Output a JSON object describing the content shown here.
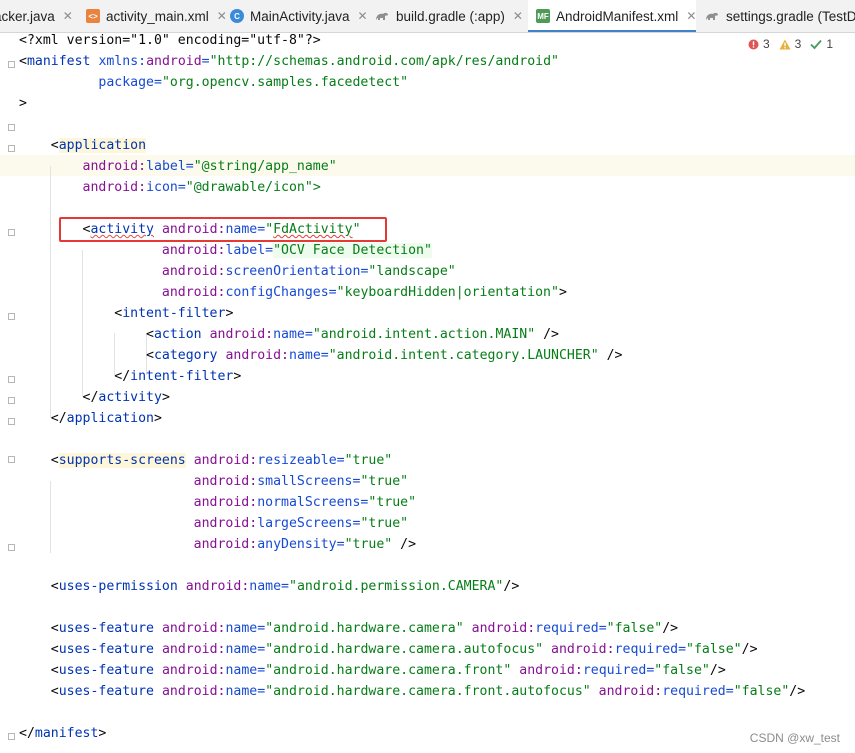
{
  "tabs": [
    {
      "label": "acker.java",
      "icon": "java-file-icon",
      "active": false
    },
    {
      "label": "activity_main.xml",
      "icon": "xml-file-icon",
      "active": false
    },
    {
      "label": "MainActivity.java",
      "icon": "java-class-icon",
      "active": false
    },
    {
      "label": "build.gradle (:app)",
      "icon": "gradle-icon",
      "active": false
    },
    {
      "label": "AndroidManifest.xml",
      "icon": "manifest-file-icon",
      "active": true
    },
    {
      "label": "settings.gradle (TestD",
      "icon": "gradle-icon",
      "active": false
    }
  ],
  "tab_icon_glyphs": {
    "xml": "<>",
    "class": "C",
    "manifest": "MF"
  },
  "inspections": {
    "errors": "3",
    "warnings": "3",
    "weak_warnings": "1"
  },
  "code": {
    "l1_decl": "<?xml version=\"1.0\" encoding=\"utf-8\"?>",
    "l2_open": "<",
    "l2_tag": "manifest",
    "l2_sp": " ",
    "l2_ns": "xmlns:",
    "l2_attr": "android",
    "l2_eq": "=",
    "l2_val": "\"http://schemas.android.com/apk/res/android\"",
    "l3_ind": "          ",
    "l3_attr": "package",
    "l3_eq": "=",
    "l3_val": "\"org.opencv.samples.facedetect\"",
    "l4_close": ">",
    "app_ind": "    <",
    "app_tag": "application",
    "appl_ind": "        ",
    "appl_ns": "android:",
    "appl_attr": "label",
    "appl_eq": "=",
    "appl_val": "\"@string/app_name\"",
    "appi_ind": "        ",
    "appi_ns": "android:",
    "appi_attr": "icon",
    "appi_eq": "=",
    "appi_val": "\"@drawable/icon\">",
    "act_ind": "        <",
    "act_tag": "activity",
    "act_sp": " ",
    "act_ns": "android:",
    "act_attr": "name",
    "act_eq": "=",
    "act_q1": "\"",
    "act_val": "FdActivity",
    "act_q2": "\"",
    "actl_ind": "                  ",
    "actl_ns": "android:",
    "actl_attr": "label",
    "actl_eq": "=",
    "actl_val": "\"OCV Face Detection\"",
    "acts_ind": "                  ",
    "acts_ns": "android:",
    "acts_attr": "screenOrientation",
    "acts_eq": "=",
    "acts_val": "\"landscape\"",
    "actc_ind": "                  ",
    "actc_ns": "android:",
    "actc_attr": "configChanges",
    "actc_eq": "=",
    "actc_val": "\"keyboardHidden|orientation\"",
    "actc_end": ">",
    "if_ind": "            <",
    "if_tag": "intent-filter",
    "if_end": ">",
    "ia_ind": "                <",
    "ia_tag": "action",
    "ia_sp": " ",
    "ia_ns": "android:",
    "ia_attr": "name",
    "ia_eq": "=",
    "ia_val": "\"android.intent.action.MAIN\"",
    "ia_end": " />",
    "ic_ind": "                <",
    "ic_tag": "category",
    "ic_sp": " ",
    "ic_ns": "android:",
    "ic_attr": "name",
    "ic_eq": "=",
    "ic_val": "\"android.intent.category.LAUNCHER\"",
    "ic_end": " />",
    "ifc_ind": "            </",
    "ifc_tag": "intent-filter",
    "ifc_end": ">",
    "actx_ind": "        </",
    "actx_tag": "activity",
    "actx_end": ">",
    "appx_ind": "    </",
    "appx_tag": "application",
    "appx_end": ">",
    "ss_ind": "    <",
    "ss_tag": "supports-screens",
    "ss_sp": " ",
    "ss_ns": "android:",
    "ss_attr": "resizeable",
    "ss_eq": "=",
    "ss_val": "\"true\"",
    "ss2_ind": "                      ",
    "ss2_ns": "android:",
    "ss2_attr": "smallScreens",
    "ss2_eq": "=",
    "ss2_val": "\"true\"",
    "ss3_ind": "                      ",
    "ss3_ns": "android:",
    "ss3_attr": "normalScreens",
    "ss3_eq": "=",
    "ss3_val": "\"true\"",
    "ss4_ind": "                      ",
    "ss4_ns": "android:",
    "ss4_attr": "largeScreens",
    "ss4_eq": "=",
    "ss4_val": "\"true\"",
    "ss5_ind": "                      ",
    "ss5_ns": "android:",
    "ss5_attr": "anyDensity",
    "ss5_eq": "=",
    "ss5_val": "\"true\"",
    "ss5_end": " />",
    "up_ind": "    <",
    "up_tag": "uses-permission",
    "up_sp": " ",
    "up_ns": "android:",
    "up_attr": "name",
    "up_eq": "=",
    "up_val": "\"android.permission.CAMERA\"",
    "up_end": "/>",
    "uf1_ind": "    <",
    "uf1_tag": "uses-feature",
    "uf1_sp": " ",
    "uf1_ns": "android:",
    "uf1_attr": "name",
    "uf1_eq": "=",
    "uf1_val": "\"android.hardware.camera\"",
    "uf1_sp2": " ",
    "uf1_ns2": "android:",
    "uf1_attr2": "required",
    "uf1_eq2": "=",
    "uf1_val2": "\"false\"",
    "uf1_end": "/>",
    "uf2_ind": "    <",
    "uf2_tag": "uses-feature",
    "uf2_sp": " ",
    "uf2_ns": "android:",
    "uf2_attr": "name",
    "uf2_eq": "=",
    "uf2_val": "\"android.hardware.camera.autofocus\"",
    "uf2_sp2": " ",
    "uf2_ns2": "android:",
    "uf2_attr2": "required",
    "uf2_eq2": "=",
    "uf2_val2": "\"false\"",
    "uf2_end": "/>",
    "uf3_ind": "    <",
    "uf3_tag": "uses-feature",
    "uf3_sp": " ",
    "uf3_ns": "android:",
    "uf3_attr": "name",
    "uf3_eq": "=",
    "uf3_val": "\"android.hardware.camera.front\"",
    "uf3_sp2": " ",
    "uf3_ns2": "android:",
    "uf3_attr2": "required",
    "uf3_eq2": "=",
    "uf3_val2": "\"false\"",
    "uf3_end": "/>",
    "uf4_ind": "    <",
    "uf4_tag": "uses-feature",
    "uf4_sp": " ",
    "uf4_ns": "android:",
    "uf4_attr": "name",
    "uf4_eq": "=",
    "uf4_val": "\"android.hardware.camera.front.autofocus\"",
    "uf4_sp2": " ",
    "uf4_ns2": "android:",
    "uf4_attr2": "required",
    "uf4_eq2": "=",
    "uf4_val2": "\"false\"",
    "uf4_end": "/>",
    "end_open": "</",
    "end_tag": "manifest",
    "end_close": ">"
  },
  "watermark": "CSDN @xw_test",
  "colors": {
    "tag": "#0033b3",
    "namespace": "#871094",
    "attribute": "#174ad4",
    "string": "#067d17",
    "highlight_box": "#e53935",
    "active_tab_underline": "#4083c9"
  }
}
